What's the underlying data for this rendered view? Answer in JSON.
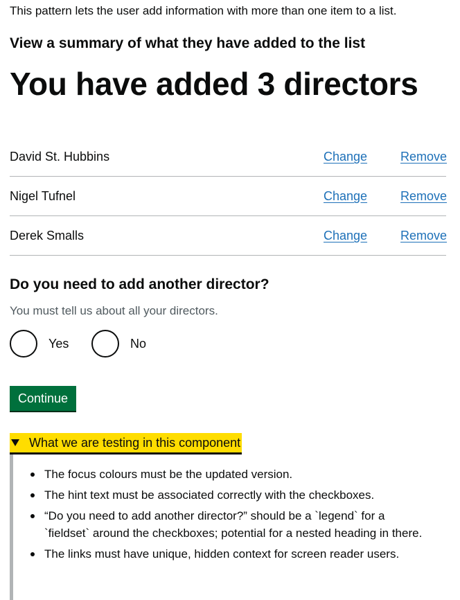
{
  "intro_text": "This pattern lets the user add information with more than one item to a list.",
  "subheading": "View a summary of what they have added to the list",
  "page_title": "You have added 3 directors",
  "directors": [
    {
      "name": "David St. Hubbins",
      "change": "Change",
      "remove": "Remove"
    },
    {
      "name": "Nigel Tufnel",
      "change": "Change",
      "remove": "Remove"
    },
    {
      "name": "Derek Smalls",
      "change": "Change",
      "remove": "Remove"
    }
  ],
  "question": {
    "legend": "Do you need to add another director?",
    "hint": "You must tell us about all your directors.",
    "options": [
      "Yes",
      "No"
    ],
    "selected": null
  },
  "continue_label": "Continue",
  "details": {
    "summary": "What we are testing in this component",
    "expanded": true,
    "items": [
      "The focus colours must be the updated version.",
      "The hint text must be associated correctly with the checkboxes.",
      "“Do you need to add another director?” should be a `legend` for a `fieldset` around the checkboxes; potential for a nested heading in there.",
      "The links must have unique, hidden context for screen reader users."
    ]
  },
  "colors": {
    "link": "#1d70b8",
    "button": "#00703c",
    "focus": "#ffdd00",
    "text": "#0b0c0c",
    "hint": "#505a5f",
    "border": "#b1b4b6"
  }
}
